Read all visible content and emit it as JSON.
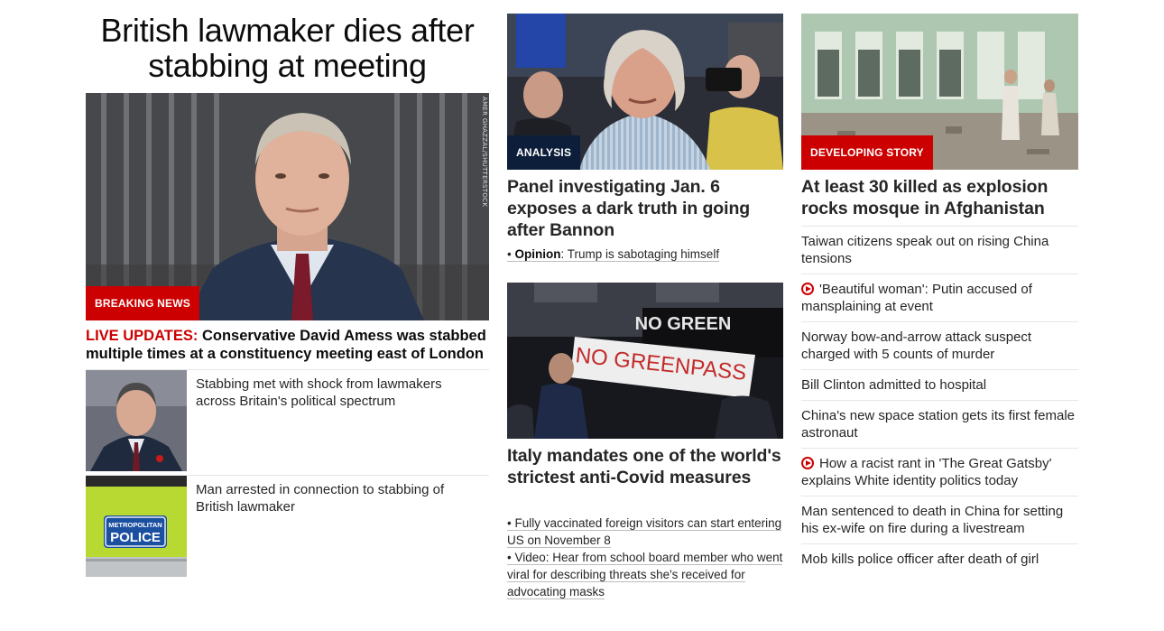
{
  "col1": {
    "headline": "British lawmaker dies after stabbing at meeting",
    "hero_badge": "BREAKING NEWS",
    "hero_credit": "AMER GHAZZAL/SHUTTERSTOCK",
    "hero_caption_prefix": "LIVE UPDATES:",
    "hero_caption": " Conservative David Amess was stabbed multiple times at a constituency meeting east of London",
    "related": [
      {
        "text": "Stabbing met with shock from lawmakers across Britain's political spectrum"
      },
      {
        "text": "Man arrested in connection to stabbing of British lawmaker"
      }
    ],
    "police_vest_text_1": "METROPOLITAN",
    "police_vest_text_2": "POLICE"
  },
  "col2": {
    "card1": {
      "badge": "ANALYSIS",
      "title": "Panel investigating Jan. 6 exposes a dark truth in going after Bannon",
      "sub_prefix": "Opinion",
      "sub_text": ": Trump is sabotaging himself"
    },
    "card2": {
      "sign_text": "NO GREENPASS",
      "banner_text": "NO GREEN",
      "title": "Italy mandates one of the world's strictest anti-Covid measures",
      "subs": [
        "Fully vaccinated foreign visitors can start entering US on November 8",
        "Video: Hear from school board member who went viral for describing threats she's received for advocating masks"
      ]
    }
  },
  "col3": {
    "badge": "DEVELOPING STORY",
    "title": "At least 30 killed as explosion rocks mosque in Afghanistan",
    "items": [
      {
        "text": "Taiwan citizens speak out on rising China tensions",
        "video": false
      },
      {
        "text": "'Beautiful woman': Putin accused of mansplaining at event",
        "video": true
      },
      {
        "text": "Norway bow-and-arrow attack suspect charged with 5 counts of murder",
        "video": false
      },
      {
        "text": "Bill Clinton admitted to hospital",
        "video": false
      },
      {
        "text": "China's new space station gets its first female astronaut",
        "video": false
      },
      {
        "text": "How a racist rant in 'The Great Gatsby' explains White identity politics today",
        "video": true
      },
      {
        "text": "Man sentenced to death in China for setting his ex-wife on fire during a livestream",
        "video": false
      },
      {
        "text": "Mob kills police officer after death of girl",
        "video": false
      }
    ]
  },
  "colors": {
    "accent_red": "#cc0000",
    "analysis_navy": "#0c1e3a",
    "text": "#262626",
    "rule": "#e6e6e6"
  }
}
